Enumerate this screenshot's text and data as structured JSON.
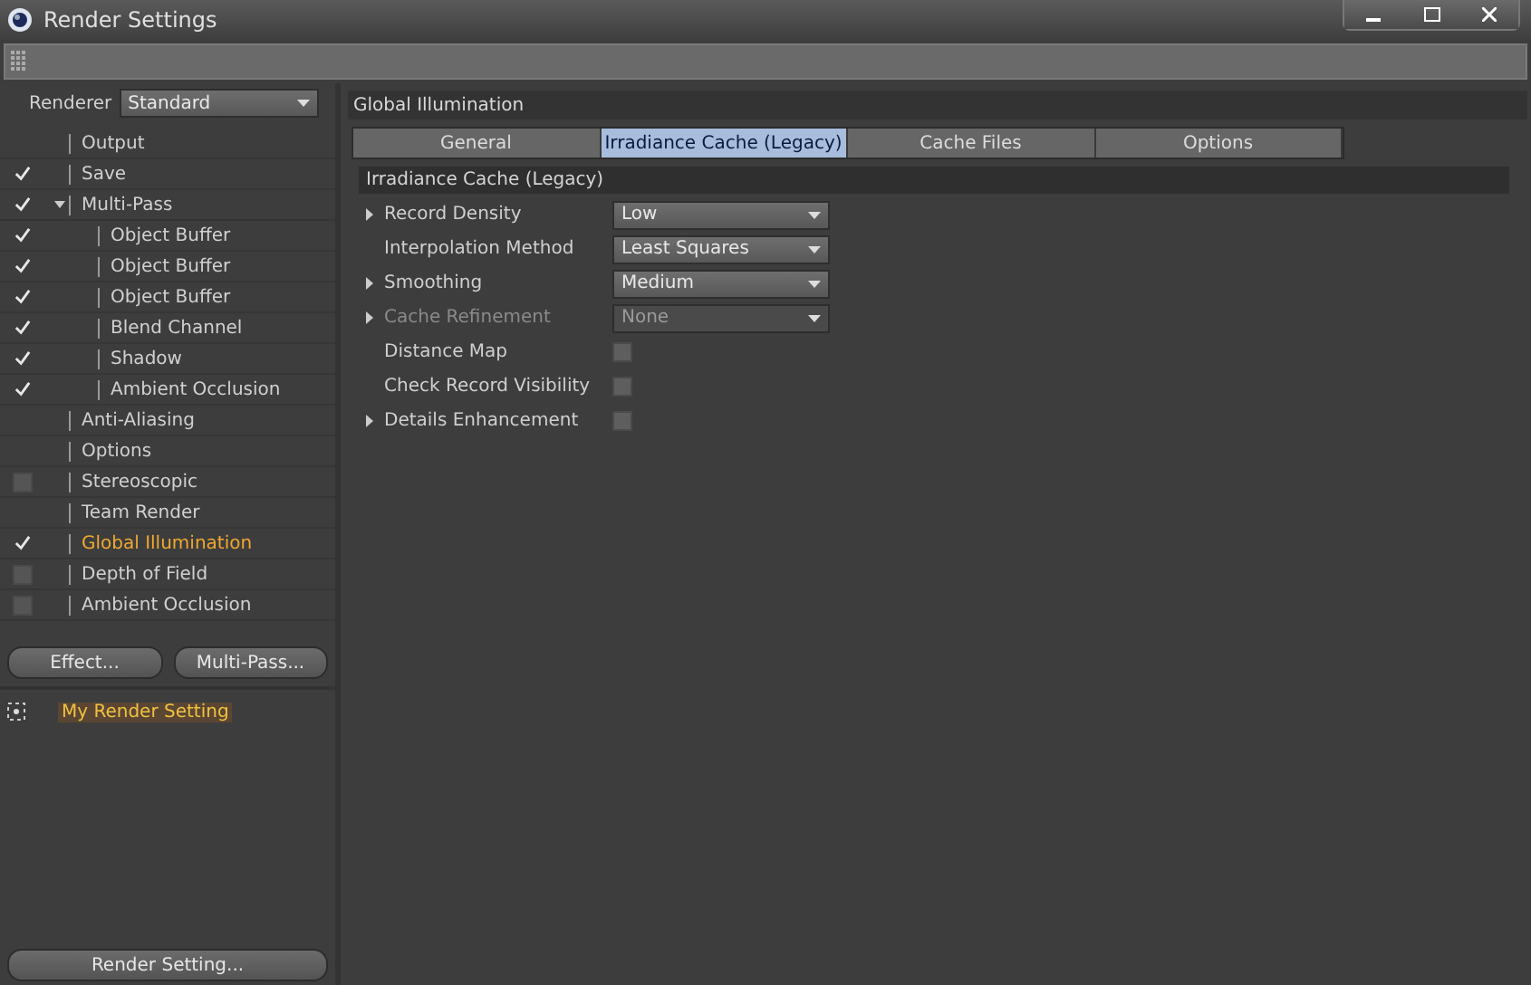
{
  "window": {
    "title": "Render Settings"
  },
  "renderer": {
    "label": "Renderer",
    "value": "Standard"
  },
  "tree": [
    {
      "label": "Output",
      "kind": "plain",
      "selected": false
    },
    {
      "label": "Save",
      "kind": "toggle",
      "checked": true,
      "selected": false
    },
    {
      "label": "Multi-Pass",
      "kind": "toggle",
      "checked": true,
      "selected": false,
      "expanded": true,
      "children": [
        {
          "label": "Object Buffer",
          "kind": "toggle",
          "checked": true,
          "selected": false
        },
        {
          "label": "Object Buffer",
          "kind": "toggle",
          "checked": true,
          "selected": false
        },
        {
          "label": "Object Buffer",
          "kind": "toggle",
          "checked": true,
          "selected": false
        },
        {
          "label": "Blend Channel",
          "kind": "toggle",
          "checked": true,
          "selected": false
        },
        {
          "label": "Shadow",
          "kind": "toggle",
          "checked": true,
          "selected": false
        },
        {
          "label": "Ambient Occlusion",
          "kind": "toggle",
          "checked": true,
          "selected": false
        }
      ]
    },
    {
      "label": "Anti-Aliasing",
      "kind": "plain",
      "selected": false
    },
    {
      "label": "Options",
      "kind": "plain",
      "selected": false
    },
    {
      "label": "Stereoscopic",
      "kind": "toggle",
      "checked": false,
      "selected": false
    },
    {
      "label": "Team Render",
      "kind": "plain",
      "selected": false
    },
    {
      "label": "Global Illumination",
      "kind": "toggle",
      "checked": true,
      "selected": true
    },
    {
      "label": "Depth of Field",
      "kind": "toggle",
      "checked": false,
      "selected": false
    },
    {
      "label": "Ambient Occlusion",
      "kind": "toggle",
      "checked": false,
      "selected": false
    }
  ],
  "tree_buttons": [
    "Effect...",
    "Multi-Pass..."
  ],
  "presets": [
    {
      "label": "My Render Setting",
      "selected": true
    }
  ],
  "bottom_button": "Render Setting...",
  "section_title": "Global Illumination",
  "tabs": [
    {
      "label": "General",
      "selected": false
    },
    {
      "label": "Irradiance Cache (Legacy)",
      "selected": true
    },
    {
      "label": "Cache Files",
      "selected": false
    },
    {
      "label": "Options",
      "selected": false
    }
  ],
  "group_title": "Irradiance Cache (Legacy)",
  "params": [
    {
      "label": "Record Density",
      "kind": "dropdown",
      "value": "Low",
      "expandable": true,
      "disabled": false
    },
    {
      "label": "Interpolation Method",
      "kind": "dropdown",
      "value": "Least Squares",
      "expandable": false,
      "disabled": false
    },
    {
      "label": "Smoothing",
      "kind": "dropdown",
      "value": "Medium",
      "expandable": true,
      "disabled": false
    },
    {
      "label": "Cache Refinement",
      "kind": "dropdown",
      "value": "None",
      "expandable": true,
      "disabled": true
    },
    {
      "label": "Distance Map",
      "kind": "checkbox",
      "checked": false,
      "expandable": false,
      "disabled": false
    },
    {
      "label": "Check Record Visibility",
      "kind": "checkbox",
      "checked": false,
      "expandable": false,
      "disabled": false
    },
    {
      "label": "Details Enhancement",
      "kind": "checkbox",
      "checked": false,
      "expandable": true,
      "disabled": false
    }
  ]
}
